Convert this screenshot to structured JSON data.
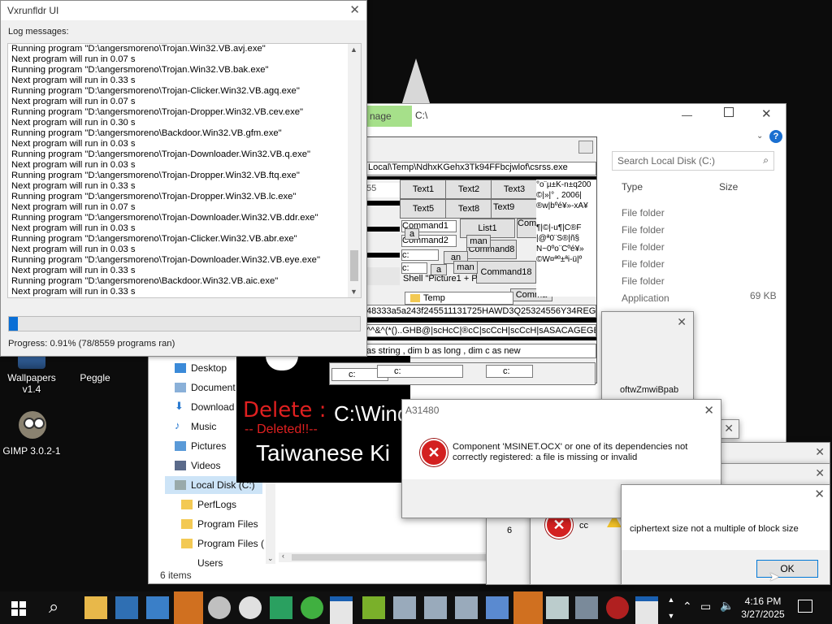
{
  "desktop": {
    "icons": [
      {
        "label_line1": "Wallpapers",
        "label_line2": "v1.4"
      },
      {
        "label_line1": "Peggle",
        "label_line2": ""
      },
      {
        "label_line1": "GIMP 3.0.2-1",
        "label_line2": ""
      }
    ]
  },
  "vxrunfldr": {
    "title": "Vxrunfldr UI",
    "log_label": "Log messages:",
    "log_lines": [
      "Running program \"D:\\angersmoreno\\Trojan.Win32.VB.avj.exe\"",
      "Next program will run in 0.07 s",
      "Running program \"D:\\angersmoreno\\Trojan.Win32.VB.bak.exe\"",
      "Next program will run in 0.33 s",
      "Running program \"D:\\angersmoreno\\Trojan-Clicker.Win32.VB.agq.exe\"",
      "Next program will run in 0.07 s",
      "Running program \"D:\\angersmoreno\\Trojan-Dropper.Win32.VB.cev.exe\"",
      "Next program will run in 0.30 s",
      "Running program \"D:\\angersmoreno\\Backdoor.Win32.VB.gfm.exe\"",
      "Next program will run in 0.03 s",
      "Running program \"D:\\angersmoreno\\Trojan-Downloader.Win32.VB.q.exe\"",
      "Next program will run in 0.03 s",
      "Running program \"D:\\angersmoreno\\Trojan-Dropper.Win32.VB.ftq.exe\"",
      "Next program will run in 0.33 s",
      "Running program \"D:\\angersmoreno\\Trojan-Dropper.Win32.VB.lc.exe\"",
      "Next program will run in 0.07 s",
      "Running program \"D:\\angersmoreno\\Trojan-Downloader.Win32.VB.ddr.exe\"",
      "Next program will run in 0.03 s",
      "Running program \"D:\\angersmoreno\\Trojan-Clicker.Win32.VB.abr.exe\"",
      "Next program will run in 0.03 s",
      "Running program \"D:\\angersmoreno\\Trojan-Downloader.Win32.VB.eye.exe\"",
      "Next program will run in 0.33 s",
      "Running program \"D:\\angersmoreno\\Backdoor.Win32.VB.aic.exe\"",
      "Next program will run in 0.33 s"
    ],
    "progress_fraction": 0.0091,
    "progress_text": "Progress: 0.91% (78/8559 programs ran)"
  },
  "explorer": {
    "tab_label": "nage",
    "address": "C:\\",
    "search_placeholder": "Search Local Disk (C:)",
    "columns": {
      "type": "Type",
      "size": "Size"
    },
    "rows": [
      {
        "type": "File folder",
        "size": ""
      },
      {
        "type": "File folder",
        "size": ""
      },
      {
        "type": "File folder",
        "size": ""
      },
      {
        "type": "File folder",
        "size": ""
      },
      {
        "type": "File folder",
        "size": ""
      },
      {
        "type": "Application",
        "size": "69 KB"
      }
    ],
    "nav": [
      "Desktop",
      "Document",
      "Download",
      "Music",
      "Pictures",
      "Videos",
      "Local Disk (C:)",
      "PerfLogs",
      "Program Files",
      "Program Files (",
      "Users"
    ],
    "status": "6 items",
    "partial_name": "oftwZmwiBpab"
  },
  "vbwin": {
    "path": "Local\\Temp\\NdhxKGehx3Tk94FFbcjwlof\\csrss.exe",
    "field_top": "55",
    "buttons": [
      "Text1",
      "Text2",
      "Text3",
      "Text5",
      "Text8",
      "Text9",
      "Command1",
      "Command2",
      "List1",
      "Command11",
      "Command8",
      "Command18",
      "Comma"
    ],
    "small_labels": [
      "a",
      "an",
      "a",
      "man",
      "man",
      "c:",
      "c:",
      "Shell  \"Picture1 + P",
      "Temp"
    ],
    "garbled1": "°o¨µ±K-n±q200",
    "garbled2": "©|»|°  ¸ 2006|",
    "garbled3": "®w|bºé¥»-xA¥",
    "garbled4": "¶|©|-u¶|C®F",
    "garbled5": "|@ª0¨S®|ñ§",
    "garbled6": "N~0ºo¨Cºé¥»",
    "garbled7": "©W¤ªº±ªi-ü|º",
    "hexline": "48333a5a243f245511131725HAWD3Q25324556Y34REGH",
    "garbled8": "^^&^(*()..GHB@|scHcC|®cC|scCcH|scCcH|sASACAGEGE",
    "combo": "as string , dim b as long , dim c as new",
    "c_labels": [
      "c:",
      "c:",
      "c:"
    ]
  },
  "blackwin": {
    "delete_label": "Delete :",
    "path_fragment": "C:\\Wind",
    "deleted_label": "-- Deleted!!--",
    "taiwanese": "Taiwanese Ki"
  },
  "msinet_dialog": {
    "title": "A31480",
    "message": "Component 'MSINET.OCX' or one of its dependencies not correctly registered: a file is missing or invalid",
    "ok": "OK"
  },
  "cipher_dialog": {
    "message": "ciphertext size not a multiple of block size",
    "ok": "OK",
    "partial_fragment": "6",
    "partial_fragment2": "cc"
  },
  "taskbar": {
    "time": "4:16 PM",
    "date": "3/27/2025"
  }
}
